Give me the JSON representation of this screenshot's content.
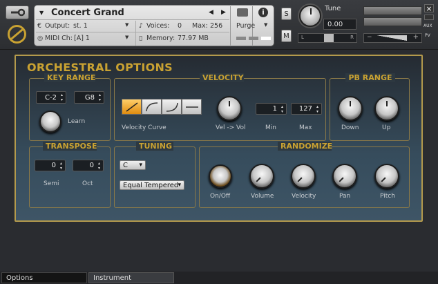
{
  "header": {
    "instrument_name": "Concert Grand",
    "output_label": "Output:",
    "output_value": "st. 1",
    "voices_label": "Voices:",
    "voices_value": "0",
    "max_label": "Max:",
    "max_value": "256",
    "midi_label": "MIDI Ch:",
    "midi_value": "[A]  1",
    "memory_label": "Memory:",
    "memory_value": "77.97 MB",
    "purge_label": "Purge",
    "tune_label": "Tune",
    "tune_value": "0.00",
    "s_label": "S",
    "m_label": "M",
    "left_label": "L",
    "right_label": "R",
    "aux_label": "AUX",
    "pv_label": "PV",
    "minus_label": "−",
    "plus_label": "+"
  },
  "panel": {
    "title": "ORCHESTRAL OPTIONS",
    "key_range": {
      "title": "KEY RANGE",
      "low": "C-2",
      "high": "G8",
      "learn_label": "Learn"
    },
    "velocity": {
      "title": "VELOCITY",
      "curve_label": "Velocity Curve",
      "vel_vol_label": "Vel -> Vol",
      "min_label": "Min",
      "min_value": "1",
      "max_label": "Max",
      "max_value": "127"
    },
    "pb_range": {
      "title": "PB RANGE",
      "down_label": "Down",
      "up_label": "Up"
    },
    "transpose": {
      "title": "TRANSPOSE",
      "semi_value": "0",
      "semi_label": "Semi",
      "oct_value": "0",
      "oct_label": "Oct"
    },
    "tuning": {
      "title": "TUNING",
      "key_value": "C",
      "temperament_value": "Equal Tempered"
    },
    "randomize": {
      "title": "RANDOMIZE",
      "onoff_label": "On/Off",
      "volume_label": "Volume",
      "velocity_label": "Velocity",
      "pan_label": "Pan",
      "pitch_label": "Pitch"
    }
  },
  "footer": {
    "tab_options": "Options",
    "tab_instrument": "Instrument"
  },
  "colors": {
    "accent_gold": "#c9a232",
    "panel_bg": "#364c5c",
    "selected_curve": "#f0a020"
  }
}
